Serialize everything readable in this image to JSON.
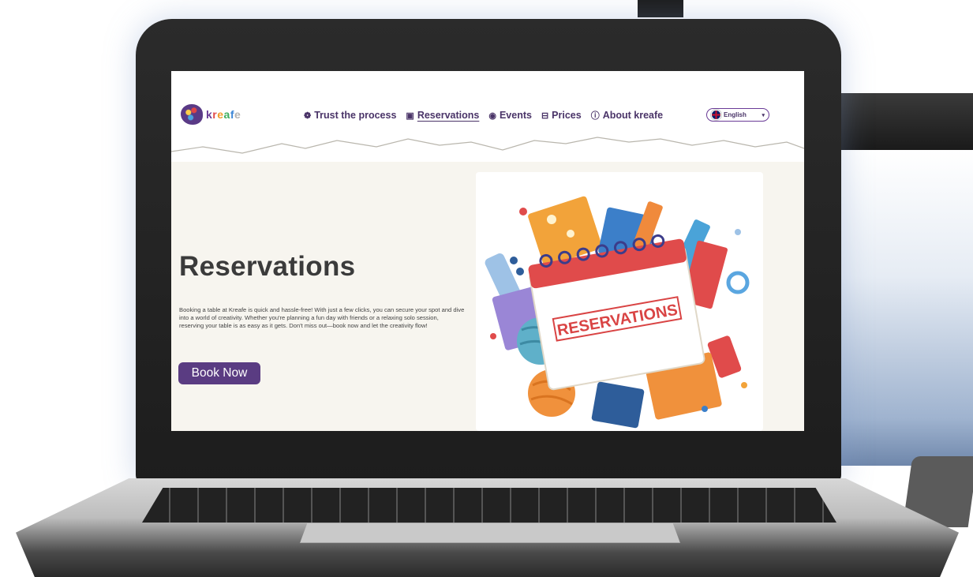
{
  "logo": {
    "letters": [
      "k",
      "r",
      "e",
      "a",
      "f",
      "e"
    ],
    "brand": "kreafe"
  },
  "nav": {
    "items": [
      {
        "label": "Trust the process",
        "icon": "palette-icon",
        "glyph": "❁"
      },
      {
        "label": "Reservations",
        "icon": "calendar-icon",
        "glyph": "▣",
        "active": true
      },
      {
        "label": "Events",
        "icon": "events-icon",
        "glyph": "◉"
      },
      {
        "label": "Prices",
        "icon": "ticket-icon",
        "glyph": "⊟"
      },
      {
        "label": "About kreafe",
        "icon": "info-icon",
        "glyph": "ⓘ"
      }
    ]
  },
  "language": {
    "selected": "English",
    "flag": "uk-flag-icon",
    "caret": "▾"
  },
  "hero": {
    "title": "Reservations",
    "description": "Booking a table at Kreafe is quick and hassle-free! With just a few clicks, you can secure your spot and dive into a world of creativity. Whether you're planning a fun day with friends or a relaxing solo session, reserving your table is as easy as it gets. Don't miss out—book now and let the creativity flow!",
    "cta": "Book Now"
  },
  "illustration": {
    "stamp_text": "RESERVATIONS"
  },
  "colors": {
    "brand_purple": "#5a3c82",
    "nav_text": "#4a3468",
    "calendar_red": "#e04b4b",
    "page_bg": "#f7f5ef"
  }
}
